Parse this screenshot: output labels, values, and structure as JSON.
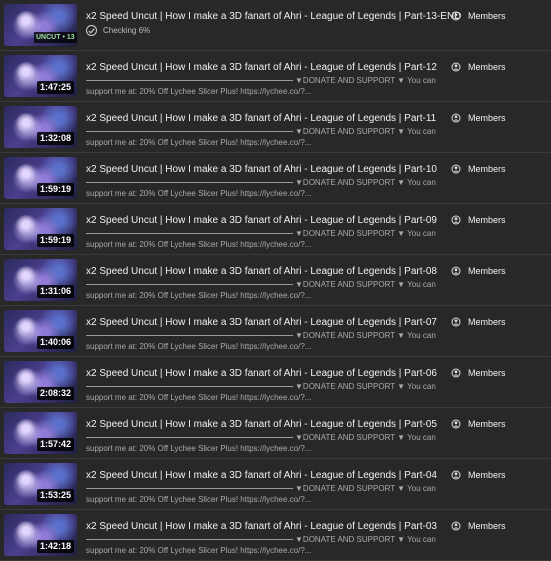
{
  "videos": [
    {
      "title": "x2 Speed Uncut | How I make a 3D fanart of Ahri - League of Legends | Part-13-END",
      "thumb_badge": "UNCUT • 13",
      "status": "Checking 6%",
      "visibility": "Members"
    },
    {
      "title": "x2 Speed Uncut | How I make a 3D fanart of Ahri - League of Legends | Part-12",
      "duration": "1:47:25",
      "desc_line1": "▼DONATE AND SUPPORT ▼ You can",
      "desc_line2": "support me at: 20% Off Lychee Slicer Plus! https://lychee.co/?...",
      "visibility": "Members"
    },
    {
      "title": "x2 Speed Uncut | How I make a 3D fanart of Ahri - League of Legends | Part-11",
      "duration": "1:32:08",
      "desc_line1": "▼DONATE AND SUPPORT ▼ You can",
      "desc_line2": "support me at: 20% Off Lychee Slicer Plus! https://lychee.co/?...",
      "visibility": "Members"
    },
    {
      "title": "x2 Speed Uncut | How I make a 3D fanart of Ahri - League of Legends | Part-10",
      "duration": "1:59:19",
      "desc_line1": "▼DONATE AND SUPPORT ▼ You can",
      "desc_line2": "support me at: 20% Off Lychee Slicer Plus! https://lychee.co/?...",
      "visibility": "Members"
    },
    {
      "title": "x2 Speed Uncut | How I make a 3D fanart of Ahri - League of Legends | Part-09",
      "duration": "1:59:19",
      "desc_line1": "▼DONATE AND SUPPORT ▼ You can",
      "desc_line2": "support me at: 20% Off Lychee Slicer Plus! https://lychee.co/?...",
      "visibility": "Members"
    },
    {
      "title": "x2 Speed Uncut | How I make a 3D fanart of Ahri - League of Legends | Part-08",
      "duration": "1:31:06",
      "desc_line1": "▼DONATE AND SUPPORT ▼ You can",
      "desc_line2": "support me at: 20% Off Lychee Slicer Plus! https://lychee.co/?...",
      "visibility": "Members"
    },
    {
      "title": "x2 Speed Uncut | How I make a 3D fanart of Ahri - League of Legends | Part-07",
      "duration": "1:40:06",
      "desc_line1": "▼DONATE AND SUPPORT ▼ You can",
      "desc_line2": "support me at: 20% Off Lychee Slicer Plus! https://lychee.co/?...",
      "visibility": "Members"
    },
    {
      "title": "x2 Speed Uncut | How I make a 3D fanart of Ahri - League of Legends | Part-06",
      "duration": "2:08:32",
      "desc_line1": "▼DONATE AND SUPPORT ▼ You can",
      "desc_line2": "support me at: 20% Off Lychee Slicer Plus! https://lychee.co/?...",
      "visibility": "Members"
    },
    {
      "title": "x2 Speed Uncut | How I make a 3D fanart of Ahri - League of Legends | Part-05",
      "duration": "1:57:42",
      "desc_line1": "▼DONATE AND SUPPORT ▼ You can",
      "desc_line2": "support me at: 20% Off Lychee Slicer Plus! https://lychee.co/?...",
      "visibility": "Members"
    },
    {
      "title": "x2 Speed Uncut | How I make a 3D fanart of Ahri - League of Legends | Part-04",
      "duration": "1:53:25",
      "desc_line1": "▼DONATE AND SUPPORT ▼ You can",
      "desc_line2": "support me at: 20% Off Lychee Slicer Plus! https://lychee.co/?...",
      "visibility": "Members"
    },
    {
      "title": "x2 Speed Uncut | How I make a 3D fanart of Ahri - League of Legends | Part-03",
      "duration": "1:42:18",
      "desc_line1": "▼DONATE AND SUPPORT ▼ You can",
      "desc_line2": "support me at: 20% Off Lychee Slicer Plus! https://lychee.co/?...",
      "visibility": "Members"
    }
  ]
}
